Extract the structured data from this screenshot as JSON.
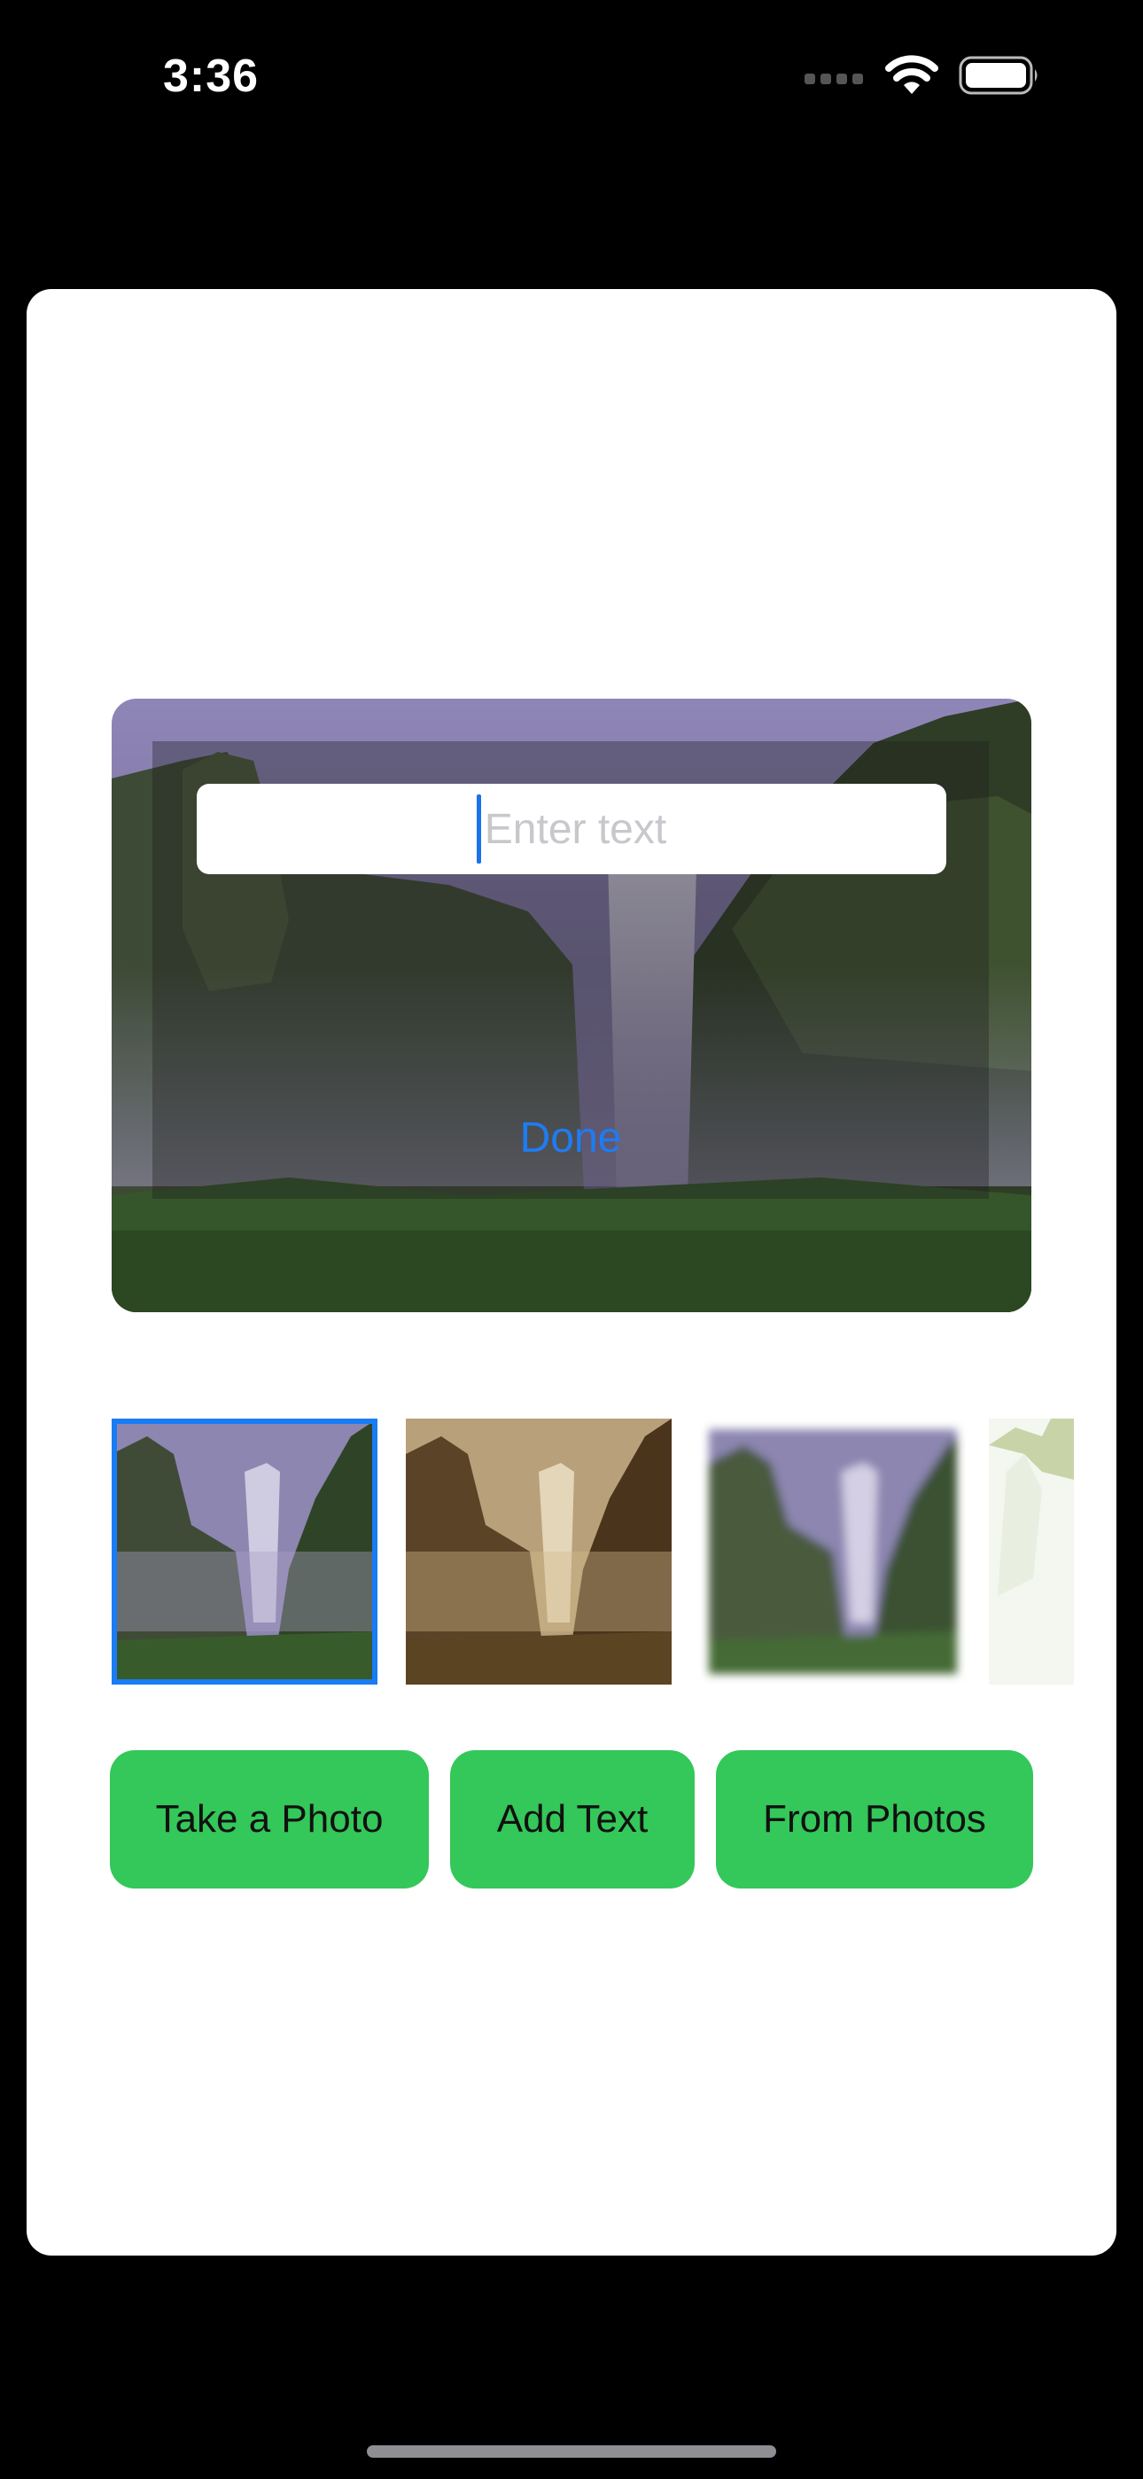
{
  "status_bar": {
    "time": "3:36",
    "icons": [
      "signal-icon",
      "wifi-icon",
      "battery-icon"
    ]
  },
  "editor": {
    "text_input": {
      "value": "",
      "placeholder": "Enter text"
    },
    "done_label": "Done"
  },
  "filters": [
    {
      "name": "original",
      "selected": true
    },
    {
      "name": "sepia",
      "selected": false
    },
    {
      "name": "blur",
      "selected": false
    },
    {
      "name": "bright",
      "selected": false
    }
  ],
  "actions": {
    "take_photo_label": "Take a Photo",
    "add_text_label": "Add Text",
    "from_photos_label": "From Photos"
  },
  "colors": {
    "accent_green": "#34c759",
    "selection_blue": "#1a7cf5",
    "link_blue": "#1e7cf2",
    "background": "#000000",
    "card": "#ffffff"
  }
}
